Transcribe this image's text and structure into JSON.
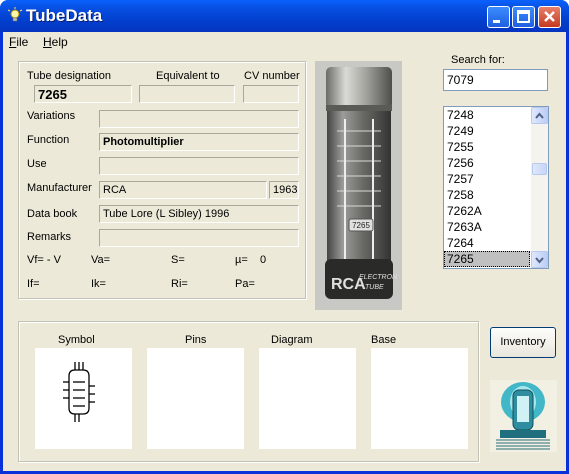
{
  "window": {
    "title": "TubeData"
  },
  "menu": {
    "file": "File",
    "file_rest": "ile",
    "file_key": "F",
    "help_key": "H",
    "help_rest": "elp"
  },
  "labels": {
    "tube_designation": "Tube designation",
    "equivalent_to": "Equivalent to",
    "cv_number": "CV number",
    "variations": "Variations",
    "function": "Function",
    "use": "Use",
    "manufacturer": "Manufacturer",
    "data_book": "Data book",
    "remarks": "Remarks",
    "vf": "Vf= - V",
    "va": "Va=",
    "s": "S=",
    "mu": "µ=",
    "mu_value": "0",
    "if": "If=",
    "ik": "Ik=",
    "ri": "Ri=",
    "pa": "Pa="
  },
  "values": {
    "tube_designation": "7265",
    "equivalent_to": "",
    "cv_number": "",
    "variations": "",
    "function": "Photomultiplier",
    "use": "",
    "manufacturer": "RCA",
    "year": "1963",
    "data_book": "Tube Lore (L Sibley) 1996",
    "remarks": ""
  },
  "search": {
    "label": "Search for:",
    "value": "7079"
  },
  "tube_list": {
    "items": [
      "7248",
      "7249",
      "7255",
      "7256",
      "7257",
      "7258",
      "7262A",
      "7263A",
      "7264",
      "7265"
    ],
    "selected": "7265"
  },
  "bottom": {
    "symbol": "Symbol",
    "pins": "Pins",
    "diagram": "Diagram",
    "base": "Base"
  },
  "inventory_button": "Inventory",
  "photo_text": {
    "line1": "RCA",
    "line2": "ELECTRON",
    "line3": "TUBE",
    "badge": "7265"
  }
}
